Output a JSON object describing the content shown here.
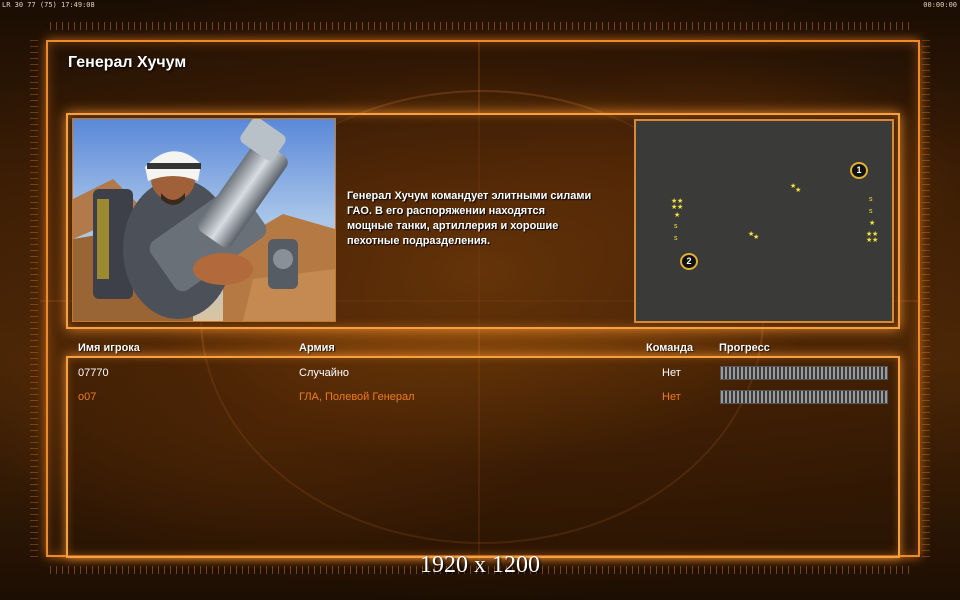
{
  "topbar": {
    "left": "LR 30  77 (75)  17:49:08",
    "right": "00:00:00"
  },
  "general": {
    "title": "Генерал Хучум",
    "description": [
      "Генерал Хучум командует элитными силами",
      "ГАО. В его распоряжении находятся",
      "мощные танки, артиллерия и хорошие",
      "пехотные подразделения."
    ]
  },
  "minimap": {
    "positions": [
      {
        "label": "1"
      },
      {
        "label": "2"
      }
    ],
    "marker_glyphs": {
      "star": "★",
      "supply": "s"
    }
  },
  "table": {
    "headers": {
      "player": "Имя игрока",
      "army": "Армия",
      "team": "Команда",
      "progress": "Прогресс"
    },
    "rows": [
      {
        "player": "07770",
        "army": "Случайно",
        "team": "Нет",
        "progress": 1.0,
        "color": "#ffffff"
      },
      {
        "player": "o07",
        "army": "ГЛА, Полевой Генерал",
        "team": "Нет",
        "progress": 1.0,
        "color": "#f07b1c"
      }
    ]
  },
  "resolution_label": "1920 x 1200",
  "colors": {
    "accent": "#f08a28",
    "frame_glow": "#f6a040",
    "player_highlight": "#f07b1c"
  }
}
